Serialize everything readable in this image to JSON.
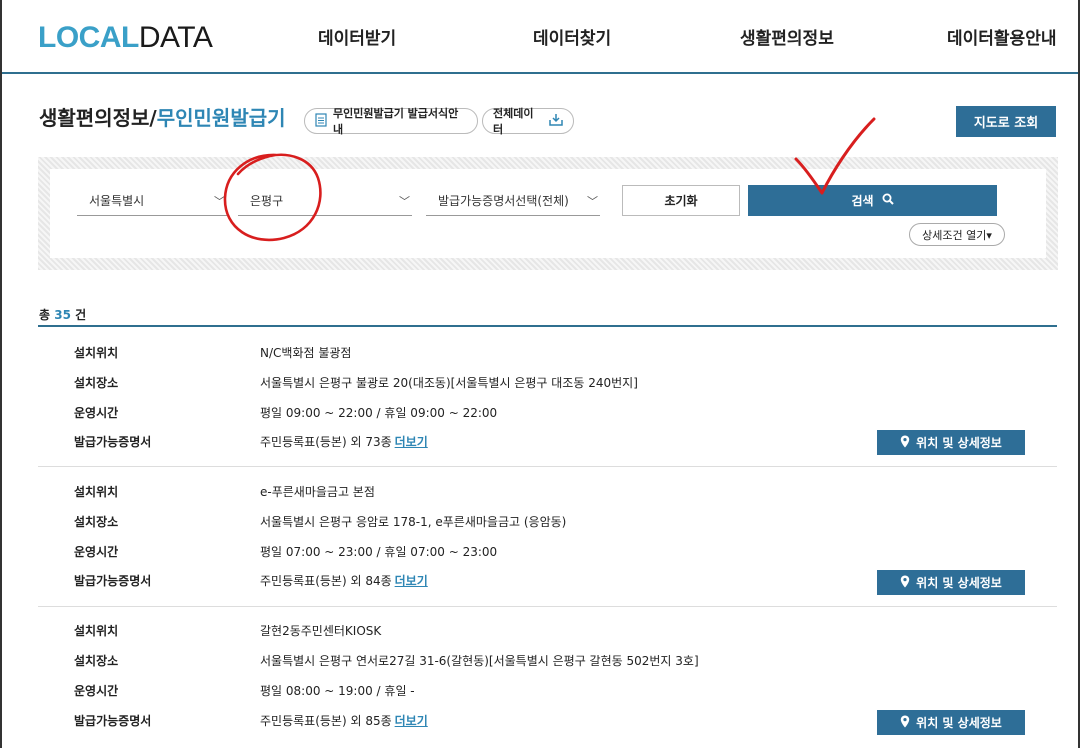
{
  "header": {
    "logo_part1": "LOCAL",
    "logo_part2": "DATA",
    "nav": [
      "데이터받기",
      "데이터찾기",
      "생활편의정보",
      "데이터활용안내"
    ]
  },
  "title": {
    "main": "생활편의정보",
    "separator": "/",
    "sub": "무인민원발급기",
    "guide_button": "무인민원발급기 발급서식안내",
    "all_data_button": "전체데이터",
    "map_button": "지도로 조회"
  },
  "search": {
    "city": "서울특별시",
    "district": "은평구",
    "document_type": "발급가능증명서선택(전체)",
    "reset_label": "초기화",
    "search_label": "검색",
    "detail_toggle": "상세조건 열기▾"
  },
  "results": {
    "total_prefix": "총",
    "total_count": "35",
    "total_suffix": "건",
    "labels": {
      "location": "설치위치",
      "address": "설치장소",
      "hours": "운영시간",
      "documents": "발급가능증명서",
      "more": "더보기",
      "detail_button": "위치 및 상세정보"
    },
    "items": [
      {
        "location": "N/C백화점 불광점",
        "address": "서울특별시 은평구 불광로 20(대조동)[서울특별시 은평구 대조동 240번지]",
        "hours": "평일 09:00 ~ 22:00 / 휴일 09:00 ~ 22:00",
        "documents": "주민등록표(등본) 외 73종"
      },
      {
        "location": "e-푸른새마을금고 본점",
        "address": "서울특별시 은평구 응암로 178-1, e푸른새마을금고 (응암동)",
        "hours": "평일 07:00 ~ 23:00 / 휴일 07:00 ~ 23:00",
        "documents": "주민등록표(등본) 외 84종"
      },
      {
        "location": "갈현2동주민센터KIOSK",
        "address": "서울특별시 은평구 연서로27길 31-6(갈현동)[서울특별시 은평구 갈현동 502번지 3호]",
        "hours": "평일 08:00 ~ 19:00 / 휴일 -",
        "documents": "주민등록표(등본) 외 85종"
      }
    ]
  },
  "colors": {
    "accent": "#2e6e97",
    "link": "#2e86b4",
    "annotation": "#d81e1e"
  }
}
